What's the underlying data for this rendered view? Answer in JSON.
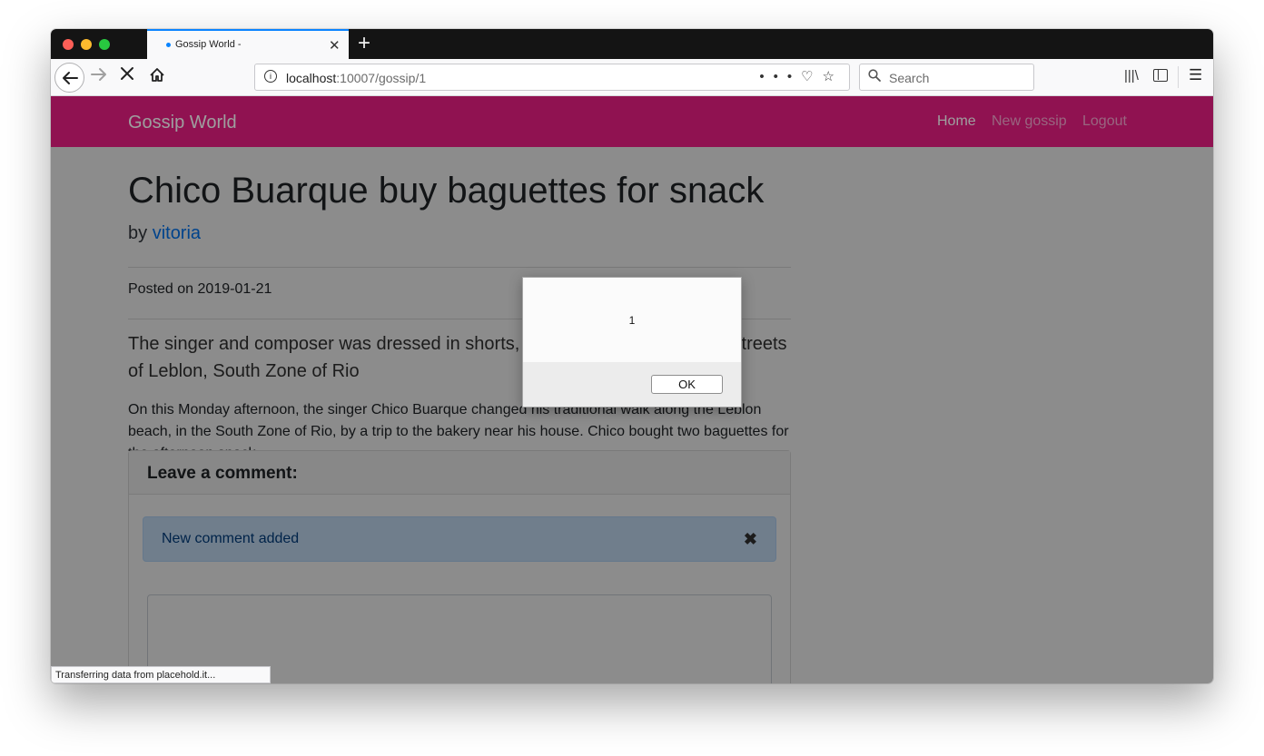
{
  "browser": {
    "tab_title": "Gossip World -",
    "url_host": "localhost",
    "url_path": ":10007/gossip/1",
    "url_actions": "•••",
    "search_placeholder": "Search",
    "status_text": "Transferring data from placehold.it..."
  },
  "site": {
    "brand": "Gossip World",
    "brand_color": "#e91d84",
    "nav": {
      "home": "Home",
      "new_gossip": "New gossip",
      "logout": "Logout"
    }
  },
  "post": {
    "title": "Chico Buarque buy baguettes for snack",
    "by_label": "by",
    "author": "vitoria",
    "posted_label": "Posted on",
    "posted_date": "2019-01-21",
    "lead": "The singer and composer was dressed in shorts, T-shirt and slippers in the streets of Leblon, South Zone of Rio",
    "body": "On this Monday afternoon, the singer Chico Buarque changed his traditional walk along the Leblon beach, in the South Zone of Rio, by a trip to the bakery near his house. Chico bought two baguettes for the afternoon snack."
  },
  "comments": {
    "header": "Leave a comment:",
    "alert_text": "New comment added",
    "alert_close": "✖"
  },
  "dialog": {
    "message": "1",
    "ok_label": "OK"
  },
  "icons": {
    "back": "arrow-left-icon",
    "forward": "arrow-right-icon",
    "stop": "close-icon",
    "home": "home-icon",
    "info": "info-icon",
    "pocket": "pocket-icon",
    "bookmark": "star-icon",
    "search": "search-icon",
    "library": "library-icon",
    "sidebar": "sidebar-icon",
    "menu": "hamburger-menu-icon"
  }
}
